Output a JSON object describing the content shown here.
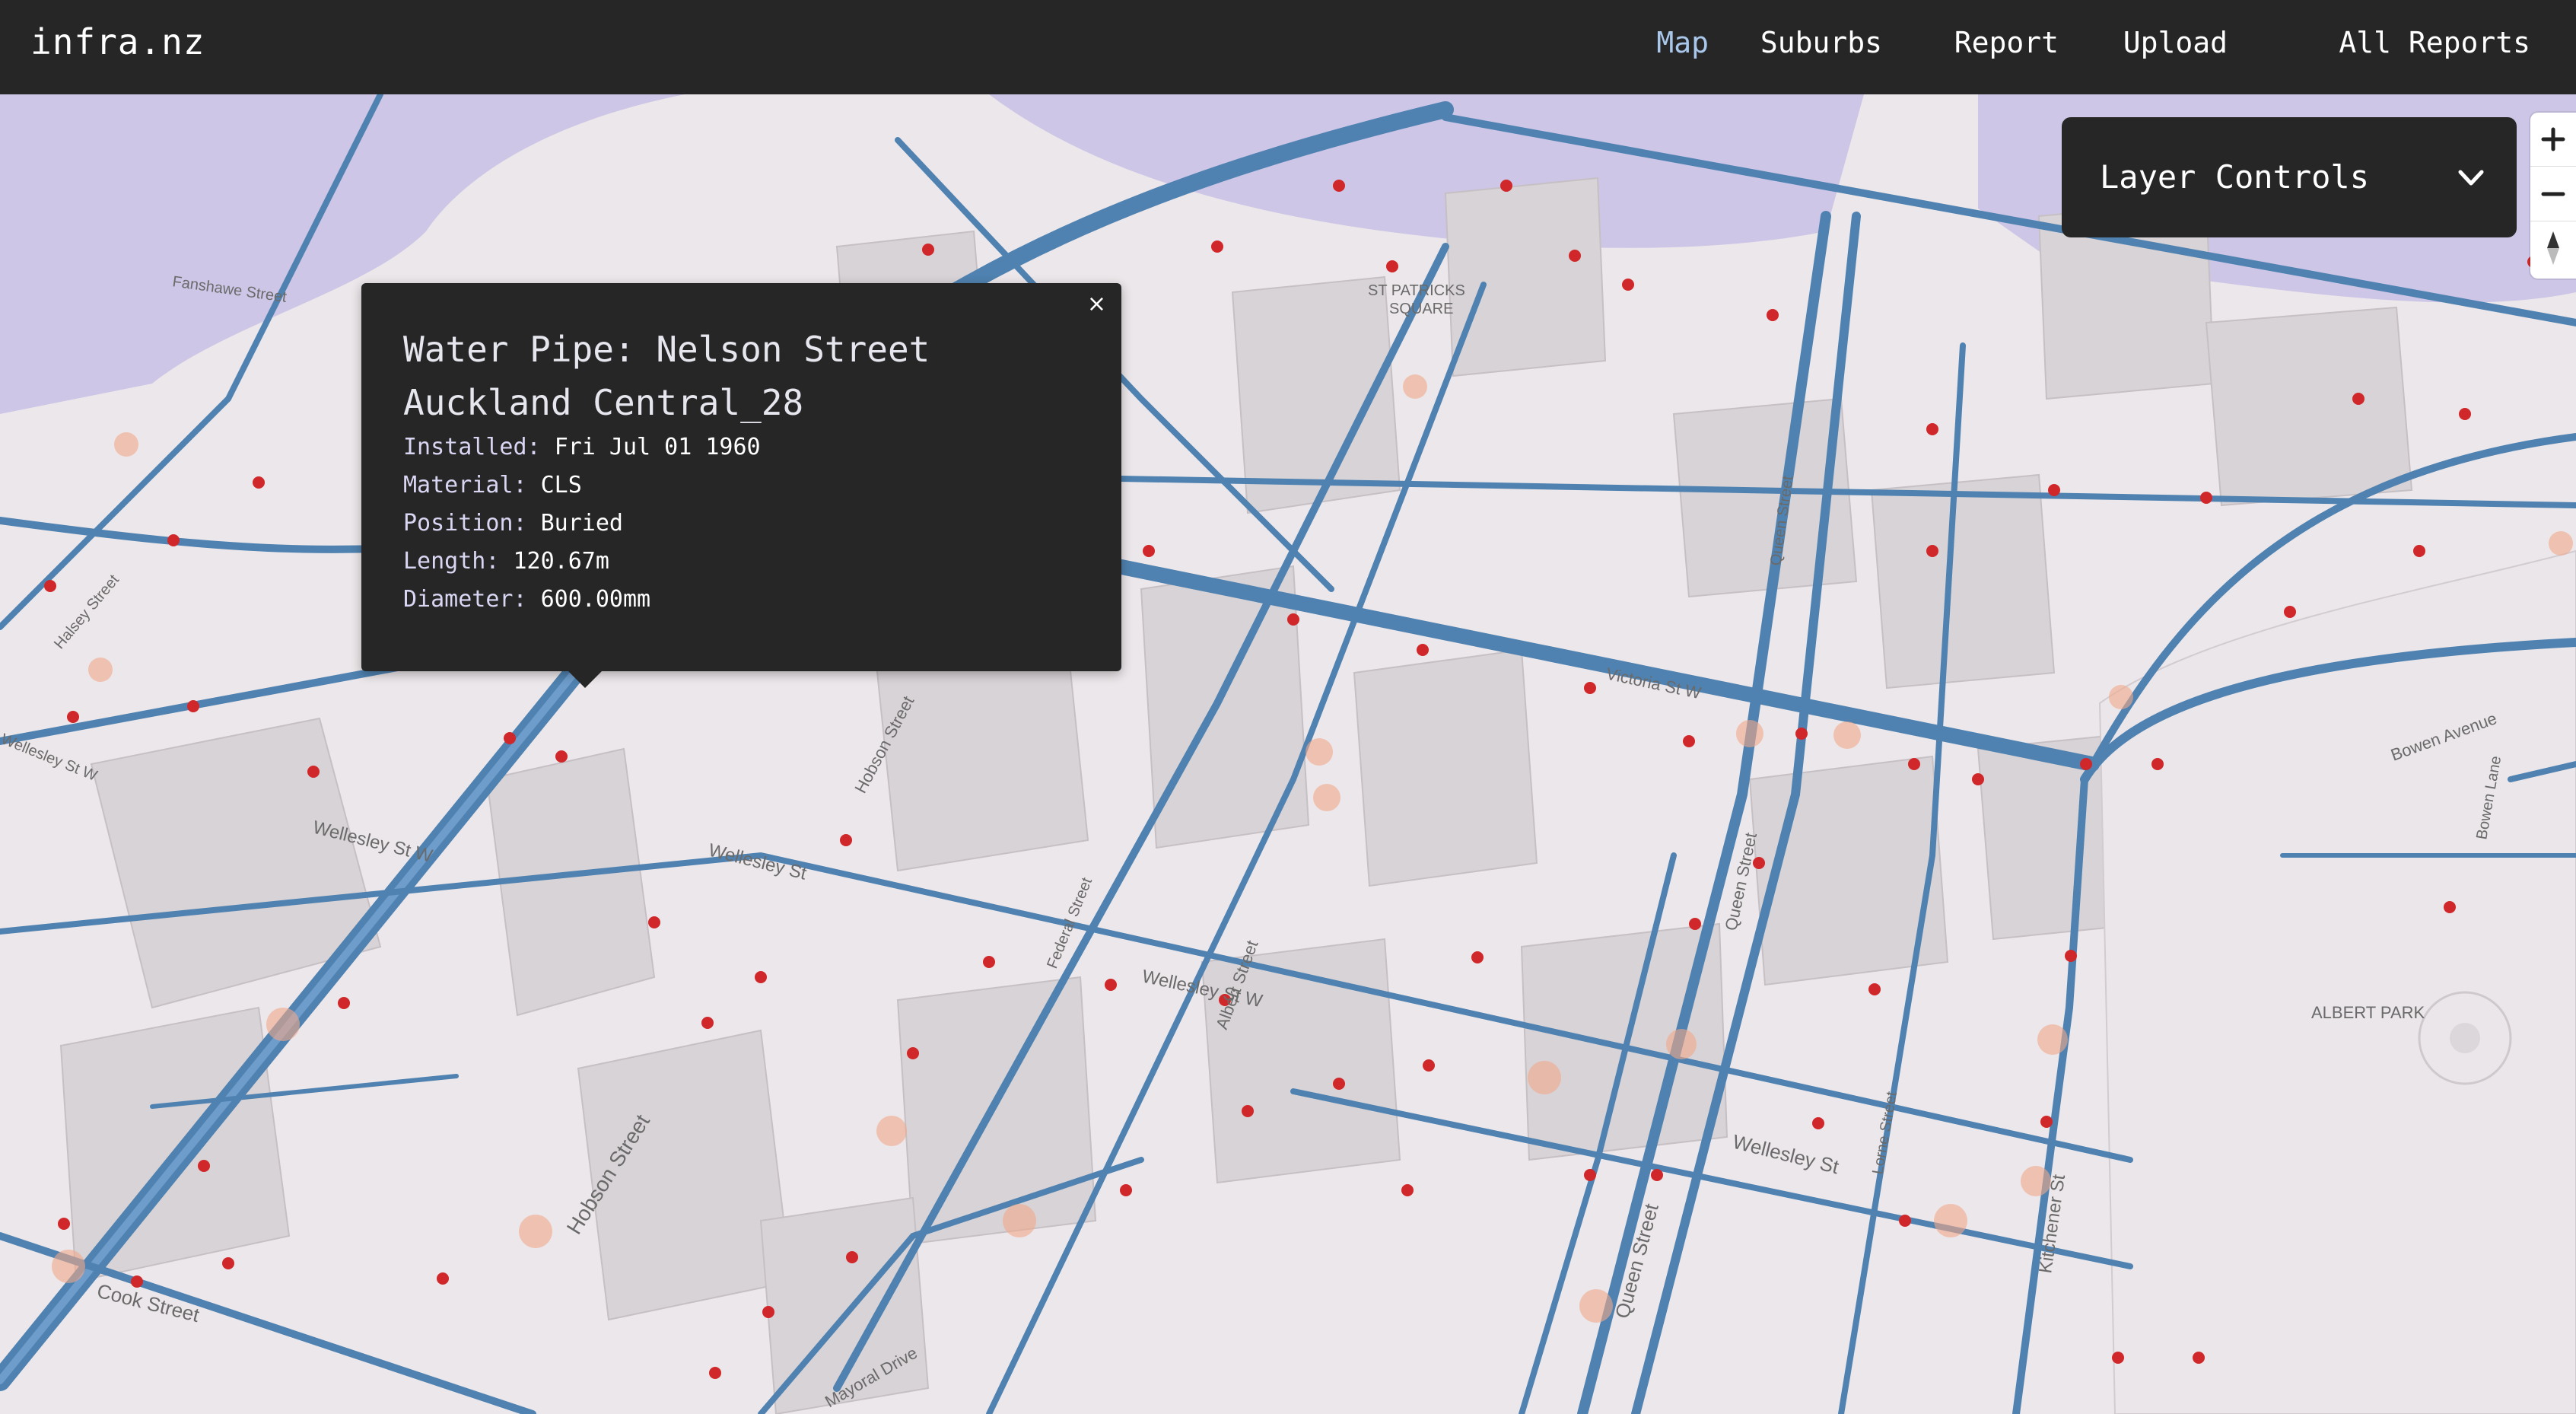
{
  "app": {
    "brand": "infra.nz"
  },
  "nav": {
    "items": [
      {
        "label": "Map",
        "active": true
      },
      {
        "label": "Suburbs",
        "active": false
      },
      {
        "label": "Report",
        "active": false
      },
      {
        "label": "Upload",
        "active": false
      },
      {
        "label": "All Reports",
        "active": false
      }
    ]
  },
  "layer_controls": {
    "label": "Layer Controls",
    "icon": "chevron-down-icon"
  },
  "zoom_controls": {
    "zoom_in_icon": "plus-icon",
    "zoom_out_icon": "minus-icon",
    "compass_icon": "compass-icon"
  },
  "popup": {
    "close_label": "×",
    "title": "Water Pipe: Nelson Street Auckland Central_28",
    "rows": [
      {
        "key": "Installed:",
        "value": "Fri Jul 01 1960"
      },
      {
        "key": "Material:",
        "value": "CLS"
      },
      {
        "key": "Position:",
        "value": "Buried"
      },
      {
        "key": "Length:",
        "value": "120.67m"
      },
      {
        "key": "Diameter:",
        "value": "600.00mm"
      }
    ]
  },
  "map_labels": {
    "st_patricks_1": "ST PATRICKS",
    "st_patricks_2": "SQUARE",
    "albert_park": "ALBERT PARK",
    "wellesley_w1": "Wellesley St W",
    "wellesley_w2": "Wellesley St W",
    "wellesley_st": "Wellesley St",
    "wellesley_east": "Wellesley St",
    "victoria_st": "Victoria St W",
    "hobson_1": "Hobson Street",
    "hobson_2": "Hobson Street",
    "queen_1": "Queen Street",
    "queen_2": "Queen Street",
    "queen_3": "Queen Street",
    "albert_st": "Albert Street",
    "federal_st": "Federal Street",
    "lorne_st": "Lorne Street",
    "kitchener_st": "Kitchener St",
    "bowen_ave": "Bowen Avenue",
    "bowen_lane": "Bowen Lane",
    "mayoral_dr": "Mayoral Drive",
    "cook_st": "Cook Street",
    "fanshawe_st": "Fanshawe Street",
    "halsey_st": "Halsey Street",
    "wellesley_left": "Wellesley St W"
  },
  "map_colors": {
    "pipe": "#4f82b0",
    "pipe_highlight": "#3a6e9e",
    "valve": "#d0282a",
    "hydrant_zone": "#f2a88a",
    "flood_zone": "#b9b1e4",
    "ground": "#ece7ea",
    "building": "#d6d1d4"
  }
}
